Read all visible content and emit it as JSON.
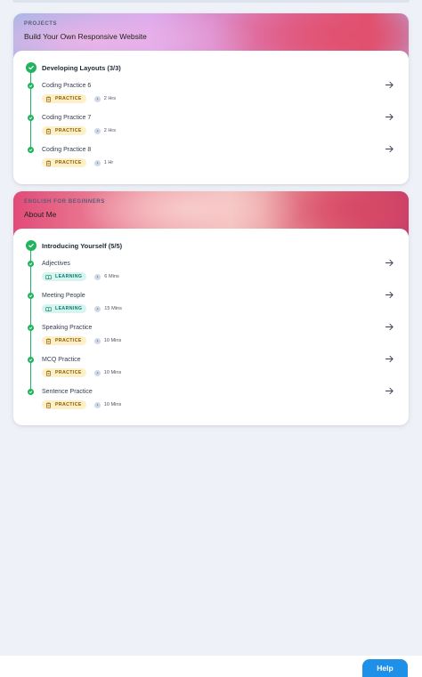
{
  "colors": {
    "page_bg": "#eef2f8",
    "check_green": "#22b35e",
    "practice_badge_bg": "#fdf0c8",
    "learning_badge_bg": "#d6f5ef",
    "help_button": "#1e90e8"
  },
  "cards": [
    {
      "label": "PROJECTS",
      "title": "Build Your Own Responsive Website",
      "section": {
        "title": "Developing Layouts (3/3)",
        "items": [
          {
            "title": "Coding Practice 6",
            "badge": "PRACTICE",
            "duration": "2 Hrs",
            "icon": "clipboard-icon"
          },
          {
            "title": "Coding Practice 7",
            "badge": "PRACTICE",
            "duration": "2 Hrs",
            "icon": "clipboard-icon"
          },
          {
            "title": "Coding Practice 8",
            "badge": "PRACTICE",
            "duration": "1 Hr",
            "icon": "clipboard-icon"
          }
        ]
      }
    },
    {
      "label": "ENGLISH FOR BEGINNERS",
      "title": "About Me",
      "section": {
        "title": "Introducing Yourself (5/5)",
        "items": [
          {
            "title": "Adjectives",
            "badge": "LEARNING",
            "duration": "6 Mins",
            "icon": "book-icon"
          },
          {
            "title": "Meeting People",
            "badge": "LEARNING",
            "duration": "15 Mins",
            "icon": "book-icon"
          },
          {
            "title": "Speaking Practice",
            "badge": "PRACTICE",
            "duration": "10 Mins",
            "icon": "clipboard-icon"
          },
          {
            "title": "MCQ Practice",
            "badge": "PRACTICE",
            "duration": "10 Mins",
            "icon": "clipboard-icon"
          },
          {
            "title": "Sentence Practice",
            "badge": "PRACTICE",
            "duration": "10 Mins",
            "icon": "clipboard-icon"
          }
        ]
      }
    }
  ],
  "footer": {
    "help_label": "Help"
  }
}
